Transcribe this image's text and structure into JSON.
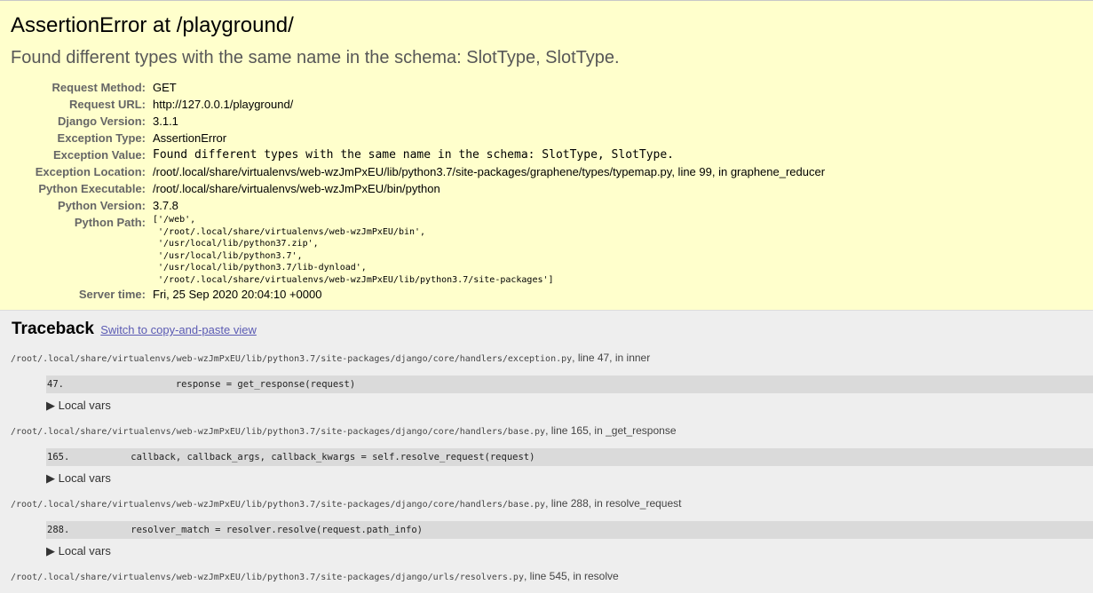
{
  "summary": {
    "title": "AssertionError at /playground/",
    "message": "Found different types with the same name in the schema: SlotType, SlotType.",
    "rows": [
      {
        "label": "Request Method:",
        "value": "GET",
        "mono": false
      },
      {
        "label": "Request URL:",
        "value": "http://127.0.0.1/playground/",
        "mono": false
      },
      {
        "label": "Django Version:",
        "value": "3.1.1",
        "mono": false
      },
      {
        "label": "Exception Type:",
        "value": "AssertionError",
        "mono": false
      },
      {
        "label": "Exception Value:",
        "value": "Found different types with the same name in the schema: SlotType, SlotType.",
        "mono": true
      },
      {
        "label": "Exception Location:",
        "value": "/root/.local/share/virtualenvs/web-wzJmPxEU/lib/python3.7/site-packages/graphene/types/typemap.py, line 99, in graphene_reducer",
        "mono": false
      },
      {
        "label": "Python Executable:",
        "value": "/root/.local/share/virtualenvs/web-wzJmPxEU/bin/python",
        "mono": false
      },
      {
        "label": "Python Version:",
        "value": "3.7.8",
        "mono": false
      }
    ],
    "python_path_label": "Python Path:",
    "python_path": "['/web',\n '/root/.local/share/virtualenvs/web-wzJmPxEU/bin',\n '/usr/local/lib/python37.zip',\n '/usr/local/lib/python3.7',\n '/usr/local/lib/python3.7/lib-dynload',\n '/root/.local/share/virtualenvs/web-wzJmPxEU/lib/python3.7/site-packages']",
    "server_time_label": "Server time:",
    "server_time": "Fri, 25 Sep 2020 20:04:10 +0000"
  },
  "traceback": {
    "heading": "Traceback",
    "switch_link": "Switch to copy-and-paste view",
    "local_vars_label": "▶ Local vars",
    "frames": [
      {
        "path": "/root/.local/share/virtualenvs/web-wzJmPxEU/lib/python3.7/site-packages/django/core/handlers/exception.py",
        "suffix": ", line 47, in inner",
        "line_no": "47.",
        "code": "            response = get_response(request)"
      },
      {
        "path": "/root/.local/share/virtualenvs/web-wzJmPxEU/lib/python3.7/site-packages/django/core/handlers/base.py",
        "suffix": ", line 165, in _get_response",
        "line_no": "165.",
        "code": "    callback, callback_args, callback_kwargs = self.resolve_request(request)"
      },
      {
        "path": "/root/.local/share/virtualenvs/web-wzJmPxEU/lib/python3.7/site-packages/django/core/handlers/base.py",
        "suffix": ", line 288, in resolve_request",
        "line_no": "288.",
        "code": "    resolver_match = resolver.resolve(request.path_info)"
      },
      {
        "path": "/root/.local/share/virtualenvs/web-wzJmPxEU/lib/python3.7/site-packages/django/urls/resolvers.py",
        "suffix": ", line 545, in resolve"
      }
    ]
  }
}
